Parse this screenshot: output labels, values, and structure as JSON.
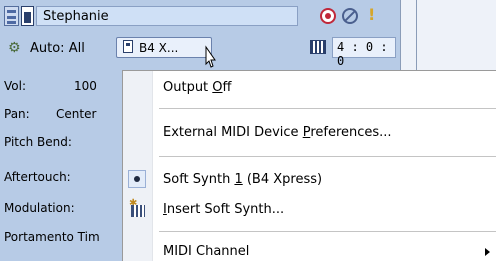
{
  "track": {
    "name": "Stephanie",
    "automation_label": "Auto: All",
    "output_button_label": "B4 X...",
    "time_value": "4 : 0 : 0",
    "icons": {
      "track_type": "track-type-icon",
      "midi": "midi-track-icon",
      "record": "record-arm-icon",
      "mute": "mute-icon",
      "solo": "solo-icon",
      "automation": "automation-icon",
      "port": "midi-port-icon",
      "piano": "piano-keyboard-icon"
    },
    "params": [
      {
        "label": "Vol:",
        "value": "100"
      },
      {
        "label": "Pan:",
        "value": "Center"
      },
      {
        "label": "Pitch Bend:",
        "value": ""
      },
      {
        "label": "Aftertouch:",
        "value": ""
      },
      {
        "label": "Modulation:",
        "value": ""
      },
      {
        "label": "Portamento Tim",
        "value": ""
      }
    ]
  },
  "menu": {
    "items": [
      {
        "pre": "Output ",
        "key": "O",
        "post": "ff"
      },
      {
        "pre": "External MIDI Device ",
        "key": "P",
        "post": "references..."
      },
      {
        "pre": "Soft Synth ",
        "key": "1",
        "post": "  (B4 Xpress)",
        "checked": true
      },
      {
        "pre": "",
        "key": "I",
        "post": "nsert Soft Synth...",
        "icon": "insert-soft-synth-icon"
      },
      {
        "pre": "MIDI Channel",
        "key": "",
        "post": "",
        "submenu": true
      }
    ]
  },
  "colors": {
    "strip_bg": "#b7cbe6",
    "record": "#c0283a",
    "solo": "#d6a62a",
    "menu_bg": "#ffffff"
  }
}
